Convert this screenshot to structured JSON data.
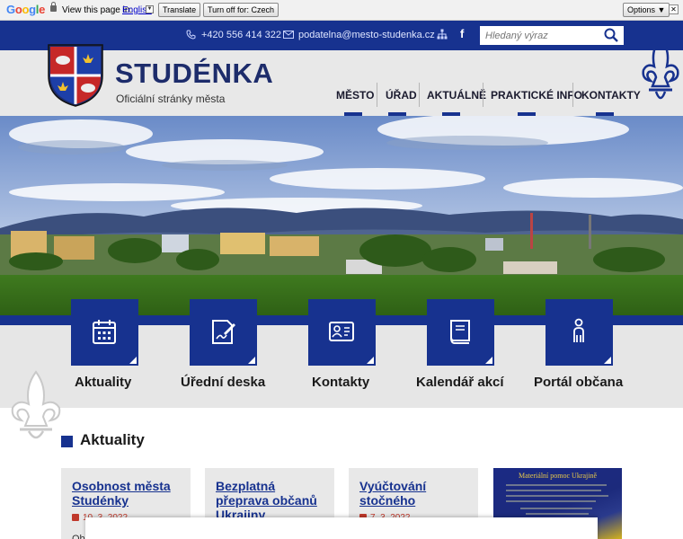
{
  "translate_bar": {
    "logo": [
      "G",
      "o",
      "o",
      "g",
      "l",
      "e"
    ],
    "view_text": "View this page in:",
    "language": "English",
    "translate_label": "Translate",
    "turn_off_label": "Turn off for: Czech",
    "options_label": "Options ▼",
    "close_label": "✕"
  },
  "contact_bar": {
    "phone": "+420 556 414 322",
    "email": "podatelna@mesto-studenka.cz",
    "facebook": "f",
    "search_placeholder": "Hledaný výraz"
  },
  "header": {
    "title": "STUDÉNKA",
    "subtitle": "Oficiální stránky města"
  },
  "nav": {
    "items": [
      "MĚSTO",
      "ÚŘAD",
      "AKTUÁLNĚ",
      "PRAKTICKÉ INFO",
      "KONTAKTY"
    ]
  },
  "tiles": {
    "items": [
      {
        "label": "Aktuality",
        "icon": "calendar-icon"
      },
      {
        "label": "Úřední deska",
        "icon": "signing-icon"
      },
      {
        "label": "Kontakty",
        "icon": "contact-card-icon"
      },
      {
        "label": "Kalendář akcí",
        "icon": "book-icon"
      },
      {
        "label": "Portál občana",
        "icon": "person-icon"
      }
    ]
  },
  "news": {
    "section_title": "Aktuality",
    "cards": [
      {
        "title": "Osobnost města Studénky",
        "date": "10. 3. 2022",
        "excerpt": "Ob"
      },
      {
        "title": "Bezplatná přeprava občanů Ukrajiny",
        "date": "",
        "excerpt": ""
      },
      {
        "title": "Vyúčtování stočného",
        "date": "7. 3. 2022",
        "excerpt": ""
      }
    ],
    "poster_title": "Materiální pomoc Ukrajině"
  },
  "colors": {
    "primary": "#17328f",
    "header_bg": "#e8e8e8",
    "accent_red": "#c0392b"
  }
}
